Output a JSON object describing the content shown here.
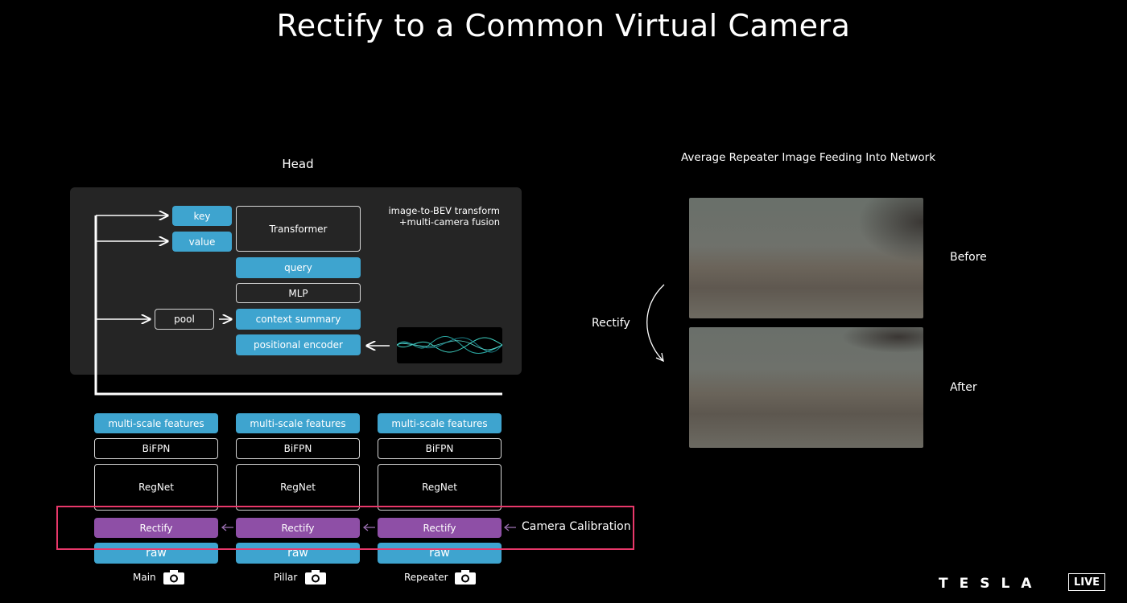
{
  "slide": {
    "title": "Rectify to a Common Virtual Camera"
  },
  "head": {
    "label": "Head",
    "fusion_line1": "image-to-BEV transform",
    "fusion_line2": "+multi-camera fusion",
    "key": "key",
    "value": "value",
    "transformer": "Transformer",
    "query": "query",
    "mlp": "MLP",
    "pool": "pool",
    "context_summary": "context summary",
    "positional_encoder": "positional encoder"
  },
  "columns": [
    {
      "features": "multi-scale features",
      "bifpn": "BiFPN",
      "regnet": "RegNet",
      "rectify": "Rectify",
      "raw": "raw",
      "camera": "Main"
    },
    {
      "features": "multi-scale features",
      "bifpn": "BiFPN",
      "regnet": "RegNet",
      "rectify": "Rectify",
      "raw": "raw",
      "camera": "Pillar"
    },
    {
      "features": "multi-scale features",
      "bifpn": "BiFPN",
      "regnet": "RegNet",
      "rectify": "Rectify",
      "raw": "raw",
      "camera": "Repeater"
    }
  ],
  "calibration": {
    "label": "Camera Calibration"
  },
  "right_panel": {
    "title": "Average Repeater Image Feeding Into Network",
    "before": "Before",
    "after": "After",
    "rectify": "Rectify"
  },
  "branding": {
    "tesla": "TESLA",
    "live": "LIVE"
  },
  "colors": {
    "blue": "#3ea4cf",
    "purple": "#8e4fa6",
    "highlight": "#e8386a",
    "panel": "#252525"
  },
  "icons": [
    "camera-icon",
    "arrow-icon",
    "curved-arrow-icon"
  ]
}
